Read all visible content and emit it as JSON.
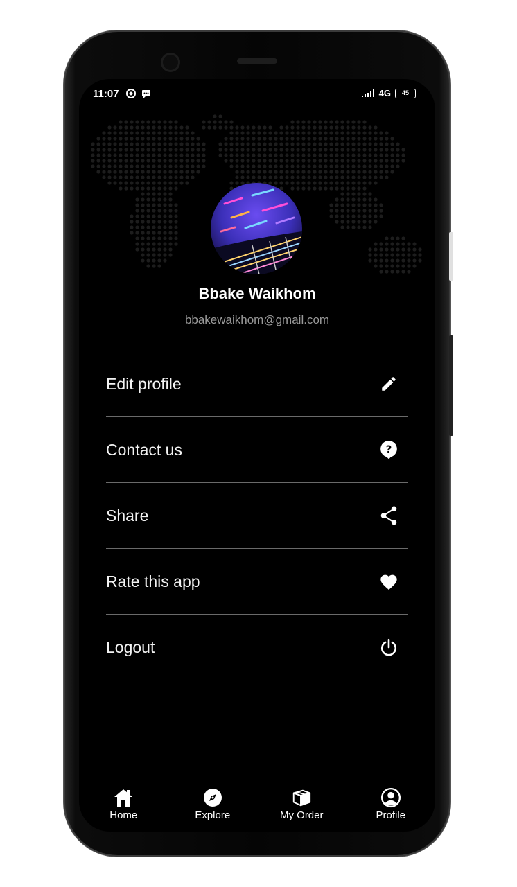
{
  "status_bar": {
    "time": "11:07",
    "network": "4G",
    "battery": "45"
  },
  "profile": {
    "name": "Bbake Waikhom",
    "email": "bbakewaikhom@gmail.com",
    "avatar_icon": "neon-guitar-avatar"
  },
  "menu": {
    "items": [
      {
        "label": "Edit profile",
        "icon": "pencil-icon"
      },
      {
        "label": "Contact us",
        "icon": "help-icon"
      },
      {
        "label": "Share",
        "icon": "share-icon"
      },
      {
        "label": "Rate this app",
        "icon": "heart-icon"
      },
      {
        "label": "Logout",
        "icon": "power-icon"
      }
    ]
  },
  "bottom_nav": {
    "items": [
      {
        "label": "Home",
        "icon": "home-icon"
      },
      {
        "label": "Explore",
        "icon": "compass-icon"
      },
      {
        "label": "My Order",
        "icon": "box-icon"
      },
      {
        "label": "Profile",
        "icon": "user-icon"
      }
    ],
    "active": "Profile"
  },
  "colors": {
    "background": "#000000",
    "text": "#ffffff",
    "muted_text": "#9a9a9a",
    "divider": "#6a6a6a"
  }
}
